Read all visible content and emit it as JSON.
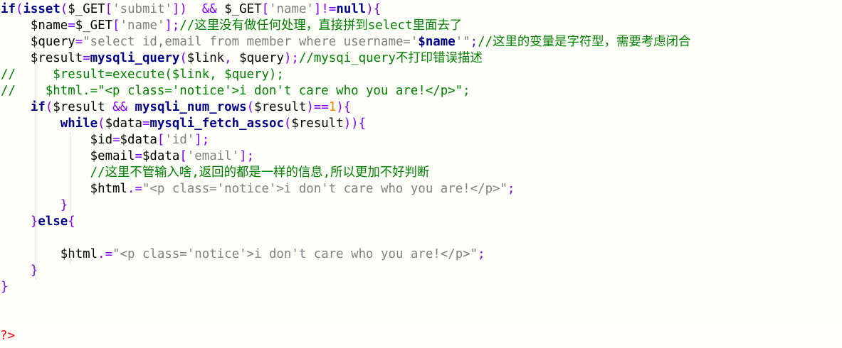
{
  "editor": {
    "language": "php",
    "lines": [
      [
        [
          "k",
          "if"
        ],
        [
          "p",
          "("
        ],
        [
          "k",
          "isset"
        ],
        [
          "p",
          "("
        ],
        [
          "v",
          "$_GET"
        ],
        [
          "p",
          "["
        ],
        [
          "s",
          "'submit'"
        ],
        [
          "p",
          "])"
        ],
        [
          "o",
          "  "
        ],
        [
          "p",
          "&&"
        ],
        [
          "o",
          " "
        ],
        [
          "v",
          "$_GET"
        ],
        [
          "p",
          "["
        ],
        [
          "s",
          "'name'"
        ],
        [
          "p",
          "]"
        ],
        [
          "p",
          "!="
        ],
        [
          "k",
          "null"
        ],
        [
          "p",
          ")"
        ],
        [
          "p",
          "{"
        ]
      ],
      [
        [
          "o",
          "    "
        ],
        [
          "v",
          "$name"
        ],
        [
          "p",
          "="
        ],
        [
          "v",
          "$_GET"
        ],
        [
          "p",
          "["
        ],
        [
          "s",
          "'name'"
        ],
        [
          "p",
          "];"
        ],
        [
          "c",
          "//这里没有做任何处理，直接拼到select里面去了"
        ]
      ],
      [
        [
          "o",
          "    "
        ],
        [
          "v",
          "$query"
        ],
        [
          "p",
          "="
        ],
        [
          "s",
          "\"select id,email from member where username='"
        ],
        [
          "k",
          "$name"
        ],
        [
          "s",
          "'\""
        ],
        [
          "p",
          ";"
        ],
        [
          "c",
          "//这里的变量是字符型，需要考虑闭合"
        ]
      ],
      [
        [
          "o",
          "    "
        ],
        [
          "v",
          "$result"
        ],
        [
          "p",
          "="
        ],
        [
          "fn",
          "mysqli_query"
        ],
        [
          "p",
          "("
        ],
        [
          "v",
          "$link"
        ],
        [
          "p",
          ", "
        ],
        [
          "v",
          "$query"
        ],
        [
          "p",
          ");"
        ],
        [
          "c",
          "//mysqi_query不打印错误描述"
        ]
      ],
      [
        [
          "c",
          "//     $result=execute($link, $query);"
        ]
      ],
      [
        [
          "c",
          "//    $html.=\"<p class='notice'>i don't care who you are!</p>\";"
        ]
      ],
      [
        [
          "o",
          "    "
        ],
        [
          "k",
          "if"
        ],
        [
          "p",
          "("
        ],
        [
          "v",
          "$result"
        ],
        [
          "o",
          " "
        ],
        [
          "p",
          "&&"
        ],
        [
          "o",
          " "
        ],
        [
          "fn",
          "mysqli_num_rows"
        ],
        [
          "p",
          "("
        ],
        [
          "v",
          "$result"
        ],
        [
          "p",
          ")"
        ],
        [
          "p",
          "=="
        ],
        [
          "n",
          "1"
        ],
        [
          "p",
          "){"
        ]
      ],
      [
        [
          "o",
          "        "
        ],
        [
          "k",
          "while"
        ],
        [
          "p",
          "("
        ],
        [
          "v",
          "$data"
        ],
        [
          "p",
          "="
        ],
        [
          "fn",
          "mysqli_fetch_assoc"
        ],
        [
          "p",
          "("
        ],
        [
          "v",
          "$result"
        ],
        [
          "p",
          "))"
        ],
        [
          "p",
          "{"
        ]
      ],
      [
        [
          "o",
          "            "
        ],
        [
          "v",
          "$id"
        ],
        [
          "p",
          "="
        ],
        [
          "v",
          "$data"
        ],
        [
          "p",
          "["
        ],
        [
          "s",
          "'id'"
        ],
        [
          "p",
          "];"
        ]
      ],
      [
        [
          "o",
          "            "
        ],
        [
          "v",
          "$email"
        ],
        [
          "p",
          "="
        ],
        [
          "v",
          "$data"
        ],
        [
          "p",
          "["
        ],
        [
          "s",
          "'email'"
        ],
        [
          "p",
          "];"
        ]
      ],
      [
        [
          "o",
          "            "
        ],
        [
          "c",
          "//这里不管输入啥,返回的都是一样的信息,所以更加不好判断"
        ]
      ],
      [
        [
          "o",
          "            "
        ],
        [
          "v",
          "$html"
        ],
        [
          "p",
          ".="
        ],
        [
          "s",
          "\"<p class='notice'>i don't care who you are!</p>\""
        ],
        [
          "p",
          ";"
        ]
      ],
      [
        [
          "o",
          "        "
        ],
        [
          "p",
          "}"
        ]
      ],
      [
        [
          "o",
          "    "
        ],
        [
          "p",
          "}"
        ],
        [
          "k",
          "else"
        ],
        [
          "p",
          "{"
        ]
      ],
      [
        [
          "o",
          ""
        ]
      ],
      [
        [
          "o",
          "        "
        ],
        [
          "v",
          "$html"
        ],
        [
          "p",
          ".="
        ],
        [
          "s",
          "\"<p class='notice'>i don't care who you are!</p>\""
        ],
        [
          "p",
          ";"
        ]
      ],
      [
        [
          "o",
          "    "
        ],
        [
          "p",
          "}"
        ]
      ],
      [
        [
          "p",
          "}"
        ]
      ],
      [
        [
          "o",
          ""
        ]
      ],
      [
        [
          "o",
          ""
        ]
      ],
      [
        [
          "tag",
          "?>"
        ]
      ]
    ]
  }
}
